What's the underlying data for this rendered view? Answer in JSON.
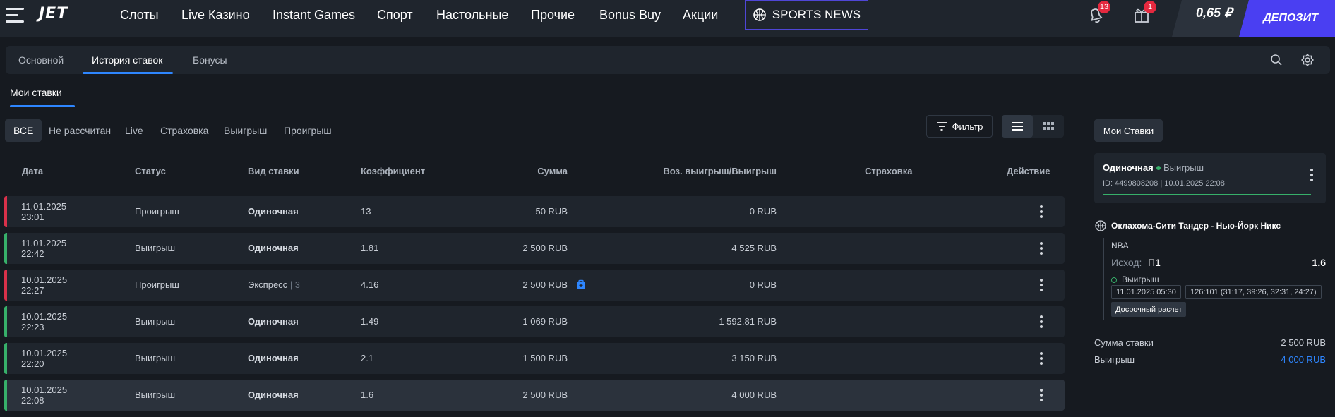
{
  "header": {
    "logo": "JET",
    "nav": [
      "Слоты",
      "Live Казино",
      "Instant Games",
      "Спорт",
      "Настольные",
      "Прочие",
      "Bonus Buy",
      "Акции"
    ],
    "sports_news": "SPORTS NEWS",
    "notifications_count": "13",
    "gifts_count": "1",
    "balance": "0,65 ₽",
    "deposit": "ДЕПОЗИТ"
  },
  "tabs": [
    "Основной",
    "История ставок",
    "Бонусы"
  ],
  "section_title": "Мои ставки",
  "filters": [
    "ВСЕ",
    "Не рассчитан",
    "Live",
    "Страховка",
    "Выигрыш",
    "Проигрыш"
  ],
  "filter_button": "Фильтр",
  "table": {
    "columns": [
      "Дата",
      "Статус",
      "Вид ставки",
      "Коэффициент",
      "Сумма",
      "Воз. выигрыш/Выигрыш",
      "Страховка",
      "Действие"
    ],
    "rows": [
      {
        "date": "11.01.2025",
        "time": "23:01",
        "status": "Проигрыш",
        "type": "Одиночная",
        "type_count": "",
        "coef": "13",
        "amount": "50 RUB",
        "payout": "0 RUB",
        "result": "lose"
      },
      {
        "date": "11.01.2025",
        "time": "22:42",
        "status": "Выигрыш",
        "type": "Одиночная",
        "type_count": "",
        "coef": "1.81",
        "amount": "2 500 RUB",
        "payout": "4 525 RUB",
        "result": "win"
      },
      {
        "date": "10.01.2025",
        "time": "22:27",
        "status": "Проигрыш",
        "type": "Экспресс",
        "type_count": "| 3",
        "coef": "4.16",
        "amount": "2 500 RUB",
        "payout": "0 RUB",
        "result": "lose"
      },
      {
        "date": "10.01.2025",
        "time": "22:23",
        "status": "Выигрыш",
        "type": "Одиночная",
        "type_count": "",
        "coef": "1.49",
        "amount": "1 069 RUB",
        "payout": "1 592.81 RUB",
        "result": "win"
      },
      {
        "date": "10.01.2025",
        "time": "22:20",
        "status": "Выигрыш",
        "type": "Одиночная",
        "type_count": "",
        "coef": "2.1",
        "amount": "1 500 RUB",
        "payout": "3 150 RUB",
        "result": "win"
      },
      {
        "date": "10.01.2025",
        "time": "22:08",
        "status": "Выигрыш",
        "type": "Одиночная",
        "type_count": "",
        "coef": "1.6",
        "amount": "2 500 RUB",
        "payout": "4 000 RUB",
        "result": "win"
      }
    ]
  },
  "panel": {
    "title": "Мои Ставки",
    "bet_type": "Одиночная",
    "bet_status": "Выигрыш",
    "bet_meta": "ID: 4499808208 | 10.01.2025 22:08",
    "match": "Оклахома-Сити Тандер - Нью-Йорк Никс",
    "league": "NBA",
    "outcome_label": "Исход:",
    "outcome_value": "П1",
    "coef": "1.6",
    "event_status": "Выигрыш",
    "event_date": "11.01.2025 05:30",
    "score": "126:101 (31:17, 39:26, 32:31, 24:27)",
    "early_settle": "Досрочный расчет",
    "stake_label": "Сумма ставки",
    "stake_value": "2 500 RUB",
    "win_label": "Выигрыш",
    "win_value": "4 000 RUB"
  },
  "colors": {
    "accent": "#2e86ff",
    "deposit": "#4a3ff2",
    "win": "#37b06a",
    "lose": "#d9314a",
    "badge": "#e5293f"
  },
  "icons": [
    "burger-menu-icon",
    "basketball-icon",
    "bell-icon",
    "gift-icon",
    "search-icon",
    "settings-icon",
    "filter-icon",
    "list-view-icon",
    "grid-view-icon",
    "insurance-icon",
    "kebab-icon"
  ]
}
